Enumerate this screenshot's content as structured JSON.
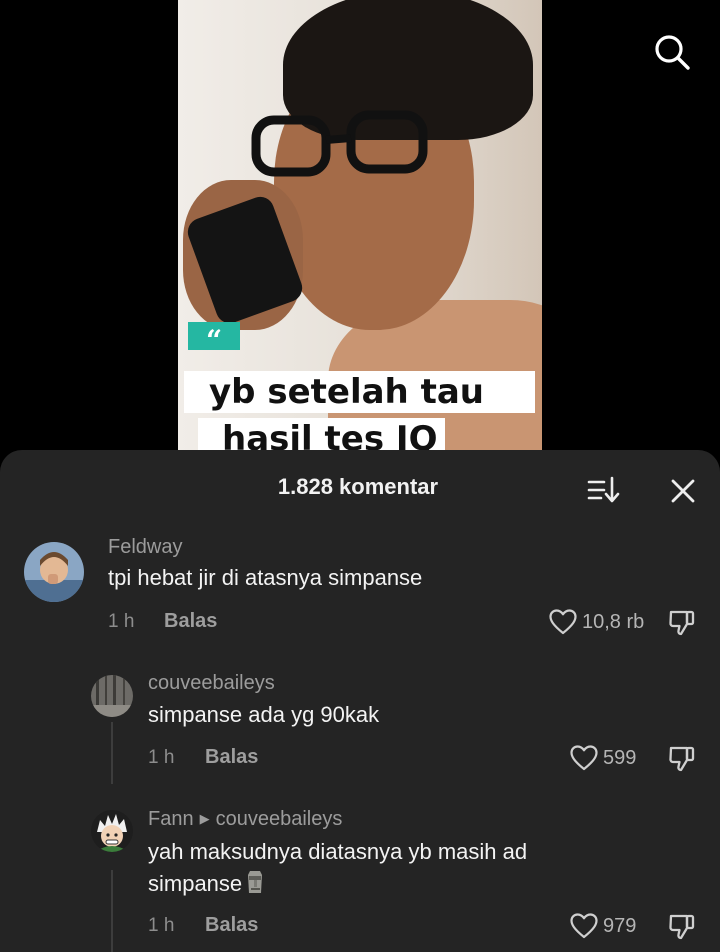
{
  "video": {
    "quote_mark": "“",
    "caption_line1": "yb setelah tau",
    "caption_line2": "hasil tes IQ"
  },
  "comments_sheet": {
    "title": "1.828 komentar"
  },
  "comments": [
    {
      "username": "Feldway",
      "text": "tpi hebat jir di atasnya simpanse",
      "time": "1 h",
      "reply_label": "Balas",
      "likes": "10,8 rb"
    },
    {
      "username": "couveebaileys",
      "text": "simpanse ada yg 90kak",
      "time": "1 h",
      "reply_label": "Balas",
      "likes": "599"
    },
    {
      "username": "Fann",
      "reply_to": "couveebaileys",
      "text_line1": "yah maksudnya diatasnya yb masih ad",
      "text_line2": "simpanse",
      "time": "1 h",
      "reply_label": "Balas",
      "likes": "979"
    }
  ],
  "icons": {
    "search": "search-icon",
    "sort": "sort-icon",
    "close": "close-icon",
    "like": "heart-icon",
    "dislike": "dislike-icon",
    "emoji": "moai-emoji-icon"
  },
  "colors": {
    "sheet_background": "#242424",
    "quote_badge": "#25b7a2"
  }
}
